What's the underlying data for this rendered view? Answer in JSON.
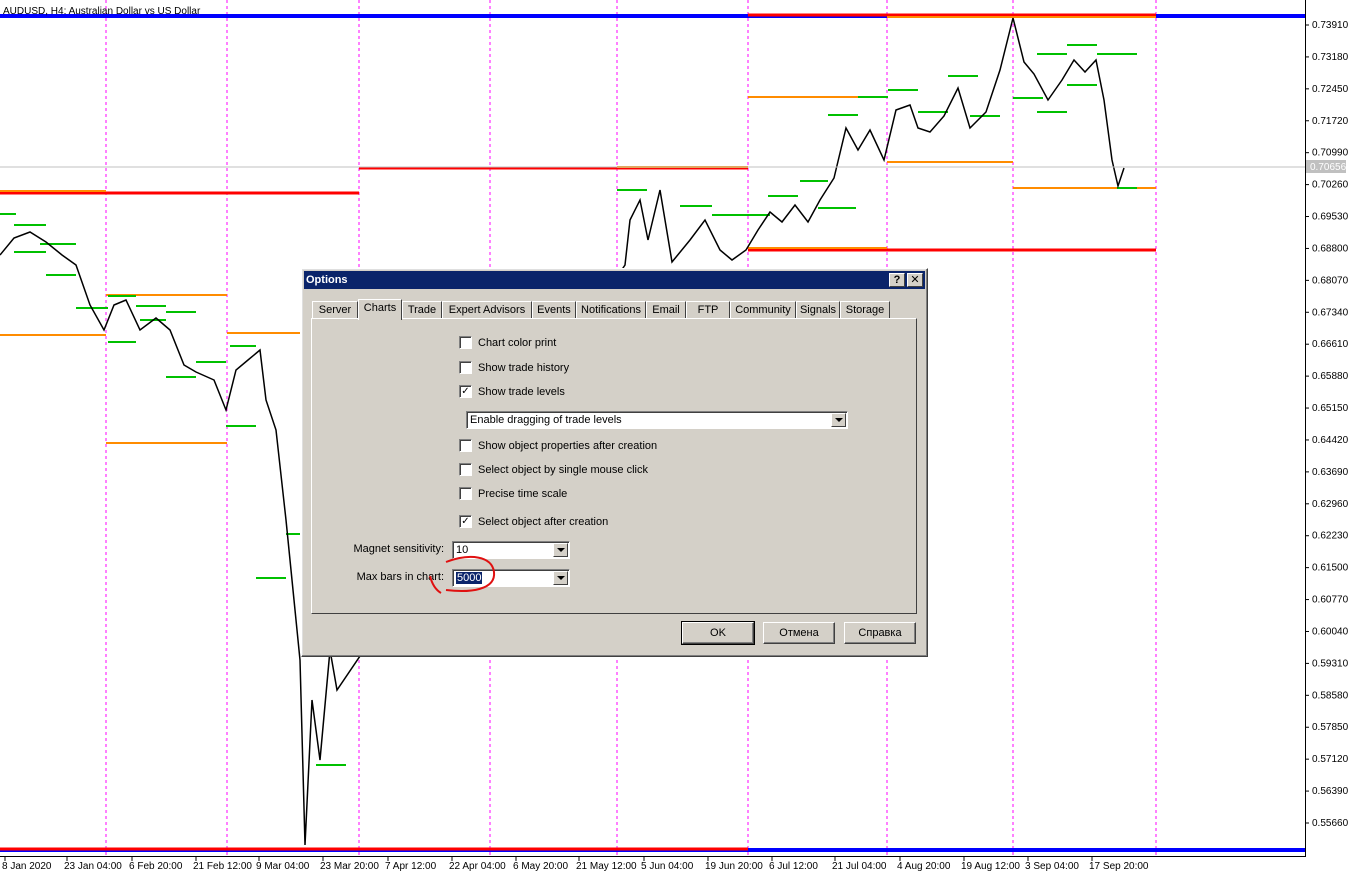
{
  "chart": {
    "title": "AUDUSD, H4:  Australian Dollar vs US Dollar",
    "current_price": "0.70656",
    "price_labels": [
      "0.73910",
      "0.73180",
      "0.72450",
      "0.71720",
      "0.70990",
      "0.70260",
      "0.69530",
      "0.68800",
      "0.68070",
      "0.67340",
      "0.66610",
      "0.65880",
      "0.65150",
      "0.64420",
      "0.63690",
      "0.62960",
      "0.62230",
      "0.61500",
      "0.60770",
      "0.60040",
      "0.59310",
      "0.58580",
      "0.57850",
      "0.57120",
      "0.56390",
      "0.55660"
    ],
    "time_labels": [
      "8 Jan 2020",
      "23 Jan 04:00",
      "6 Feb 20:00",
      "21 Feb 12:00",
      "9 Mar 04:00",
      "23 Mar 20:00",
      "7 Apr 12:00",
      "22 Apr 04:00",
      "6 May 20:00",
      "21 May 12:00",
      "5 Jun 04:00",
      "19 Jun 20:00",
      "6 Jul 12:00",
      "21 Jul 04:00",
      "4 Aug 20:00",
      "19 Aug 12:00",
      "3 Sep 04:00",
      "17 Sep 20:00"
    ],
    "colors": {
      "blue_line": "#0000ff",
      "red_line": "#ff0000",
      "orange_line": "#ff8c00",
      "green_line": "#00c000",
      "separator": "#ff00ff",
      "price": "#000000"
    }
  },
  "dialog": {
    "title": "Options",
    "help_btn": "?",
    "close_btn": "✕",
    "tabs": [
      "Server",
      "Charts",
      "Trade",
      "Expert Advisors",
      "Events",
      "Notifications",
      "Email",
      "FTP",
      "Community",
      "Signals",
      "Storage"
    ],
    "active_tab": "Charts",
    "checkboxes": [
      {
        "label": "Chart color print",
        "checked": false
      },
      {
        "label": "Show trade history",
        "checked": false
      },
      {
        "label": "Show trade levels",
        "checked": true
      },
      {
        "label": "Show object properties after creation",
        "checked": false
      },
      {
        "label": "Select object by single mouse click",
        "checked": false
      },
      {
        "label": "Precise time scale",
        "checked": false
      },
      {
        "label": "Select object after creation",
        "checked": true
      }
    ],
    "trade_levels_select": "Enable dragging of trade levels",
    "magnet_label": "Magnet sensitivity:",
    "magnet_value": "10",
    "maxbars_label": "Max bars in chart:",
    "maxbars_value": "5000",
    "buttons": {
      "ok": "OK",
      "cancel": "Отмена",
      "help": "Справка"
    }
  }
}
